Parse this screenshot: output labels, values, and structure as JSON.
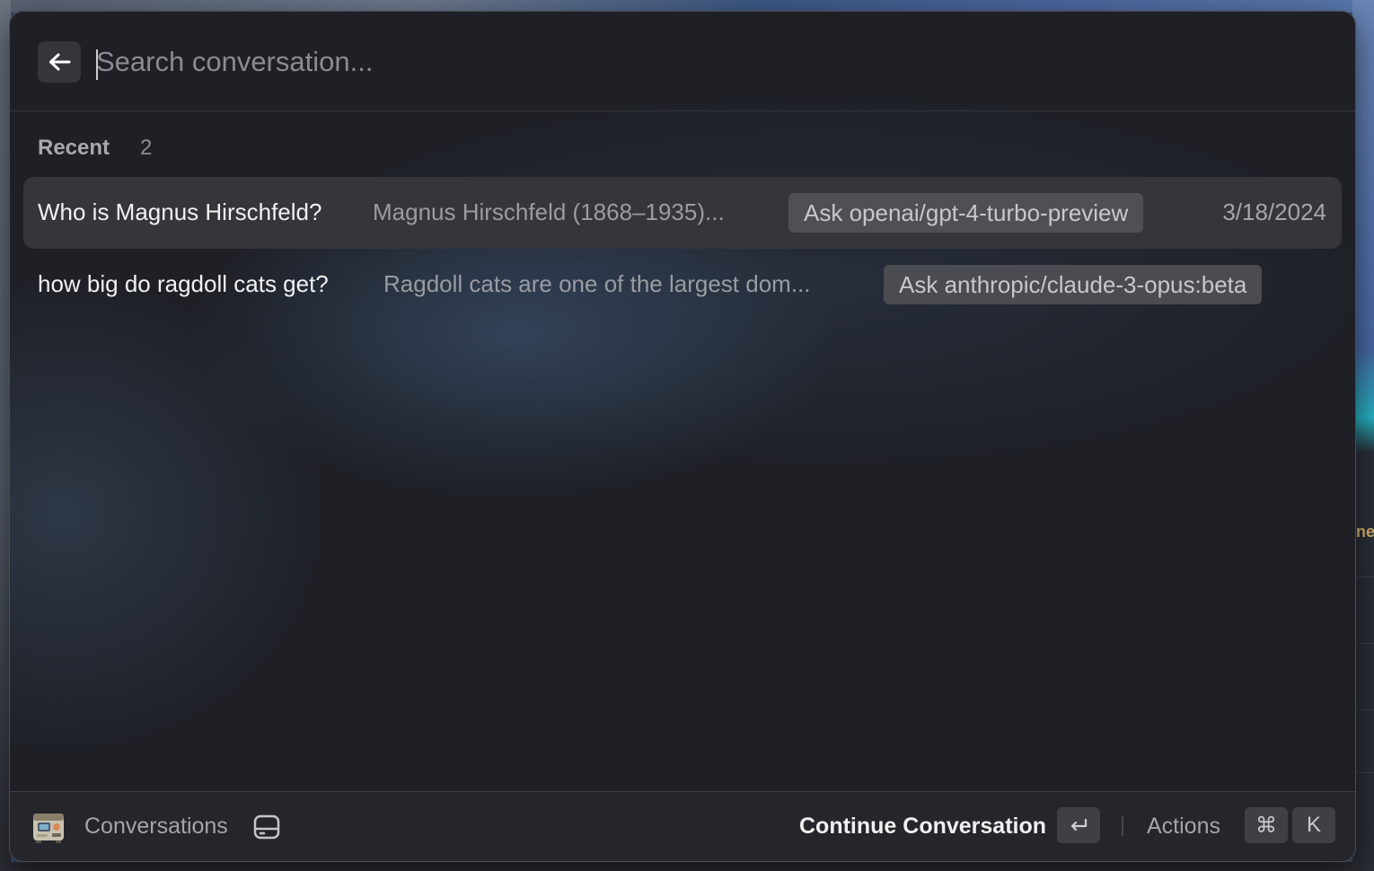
{
  "search": {
    "placeholder": "Search conversation...",
    "value": ""
  },
  "section": {
    "title": "Recent",
    "count": "2"
  },
  "conversations": [
    {
      "title": "Who is Magnus Hirschfeld?",
      "preview": "Magnus Hirschfeld (1868–1935)...",
      "model": "Ask openai/gpt-4-turbo-preview",
      "date": "3/18/2024",
      "selected": true
    },
    {
      "title": "how big do ragdoll cats get?",
      "preview": "Ragdoll cats are one of the largest dom...",
      "model": "Ask anthropic/claude-3-opus:beta",
      "date": "",
      "selected": false
    }
  ],
  "footer": {
    "app_label": "Conversations",
    "primary_action": "Continue Conversation",
    "primary_shortcut": "↵",
    "actions_label": "Actions",
    "actions_shortcut_mod": "⌘",
    "actions_shortcut_key": "K"
  },
  "background": {
    "edge_text": "ne"
  },
  "icons": {
    "back": "arrow-left-icon",
    "app": "app-icon",
    "drive": "drive-icon"
  },
  "colors": {
    "window_bg": "#1e2026",
    "selected_row": "#34363c",
    "model_tag": "#4a4c52",
    "text_primary": "#f1f1f1",
    "text_secondary": "#9a9ca2"
  }
}
